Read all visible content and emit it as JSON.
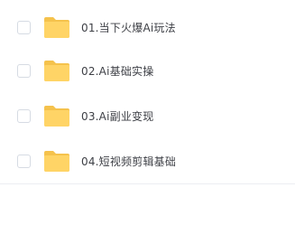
{
  "files": [
    {
      "name": "01.当下火爆Ai玩法",
      "icon": "folder-icon",
      "checked": false
    },
    {
      "name": "02.Ai基础实操",
      "icon": "folder-icon",
      "checked": false
    },
    {
      "name": "03.Ai副业变现",
      "icon": "folder-icon",
      "checked": false
    },
    {
      "name": "04.短视频剪辑基础",
      "icon": "folder-icon",
      "checked": false
    }
  ],
  "colors": {
    "folder": "#ffd466",
    "folder_tab": "#f5c24c",
    "text": "#3d3f45",
    "checkbox_border": "#d6dbe3"
  }
}
